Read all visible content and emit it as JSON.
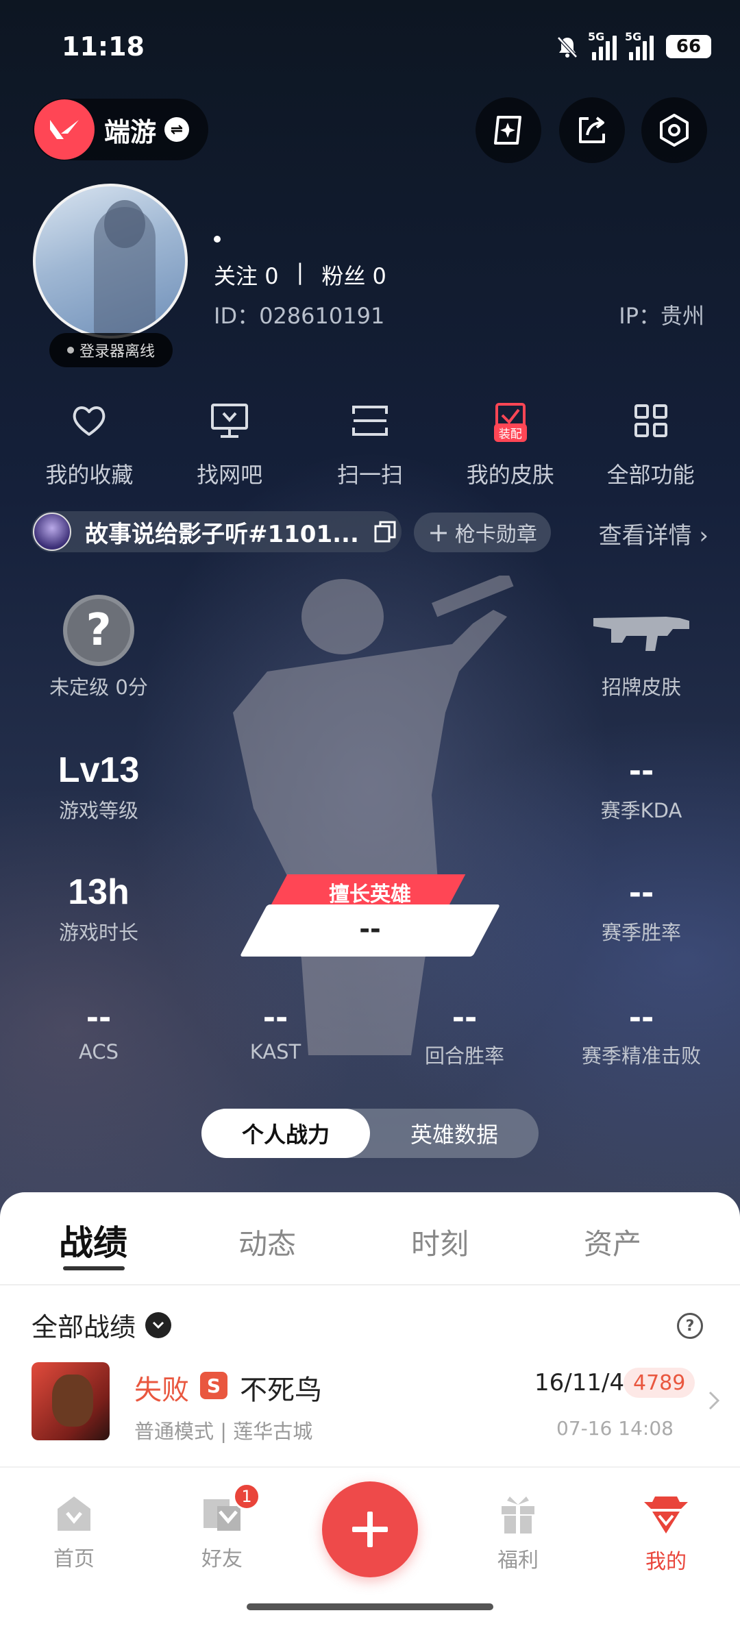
{
  "status_bar": {
    "time": "11:18",
    "network1": "5G",
    "network2": "5G",
    "battery": "66"
  },
  "header": {
    "brand": "端游"
  },
  "profile": {
    "online_status": "登录器离线",
    "follow_label": "关注",
    "follow_count": "0",
    "separator": "|",
    "fans_label": "粉丝",
    "fans_count": "0",
    "id_text": "ID：028610191",
    "ip_text": "IP：贵州"
  },
  "quick_actions": [
    {
      "label": "我的收藏",
      "icon": "heart-icon"
    },
    {
      "label": "找网吧",
      "icon": "monitor-icon"
    },
    {
      "label": "扫一扫",
      "icon": "scan-icon"
    },
    {
      "label": "我的皮肤",
      "icon": "skin-icon",
      "badge": "装配"
    },
    {
      "label": "全部功能",
      "icon": "grid-icon"
    }
  ],
  "account": {
    "name": "故事说给影子听#1101...",
    "card_medal": "枪卡勋章",
    "view_details": "查看详情"
  },
  "stats": {
    "rank": {
      "icon": "?",
      "label": "未定级 0分"
    },
    "signature_skin": "招牌皮肤",
    "level": {
      "value": "Lv13",
      "label": "游戏等级"
    },
    "season_kda": {
      "value": "--",
      "label": "赛季KDA"
    },
    "playtime": {
      "value": "13h",
      "label": "游戏时长"
    },
    "season_winrate": {
      "value": "--",
      "label": "赛季胜率"
    },
    "best_hero": {
      "label": "擅长英雄",
      "value": "--"
    },
    "bottom": [
      {
        "value": "--",
        "label": "ACS"
      },
      {
        "value": "--",
        "label": "KAST"
      },
      {
        "value": "--",
        "label": "回合胜率"
      },
      {
        "value": "--",
        "label": "赛季精准击败"
      }
    ]
  },
  "toggle": {
    "personal": "个人战力",
    "hero": "英雄数据"
  },
  "sheet": {
    "tabs": [
      "战绩",
      "动态",
      "时刻",
      "资产"
    ],
    "filter": "全部战绩",
    "help": "?",
    "match": {
      "result": "失败",
      "badge": "S",
      "agent": "不死鸟",
      "mode": "普通模式 | 莲华古城",
      "kda": "16/11/4",
      "score": "4789",
      "time": "07-16 14:08"
    }
  },
  "nav": {
    "home": "首页",
    "friends": "好友",
    "friends_badge": "1",
    "welfare": "福利",
    "mine": "我的"
  },
  "colors": {
    "accent": "#ff4655",
    "loss": "#e9573f",
    "active_nav": "#e9443a"
  }
}
